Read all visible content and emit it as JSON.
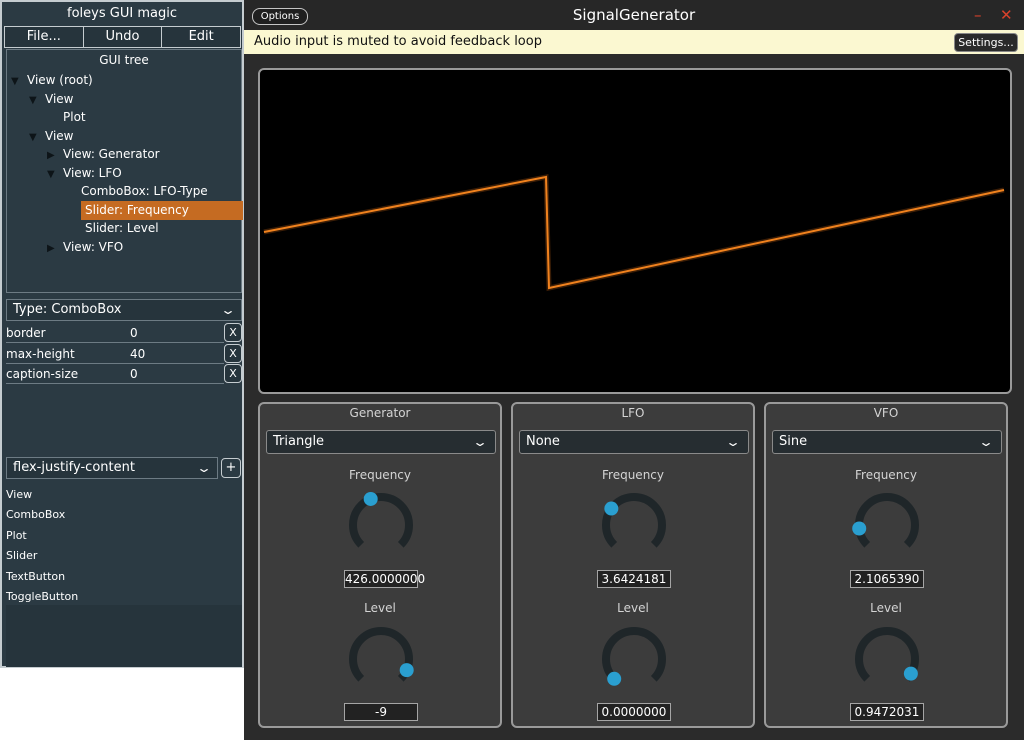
{
  "editor": {
    "title": "foleys GUI magic",
    "menu": [
      "File...",
      "Undo",
      "Edit"
    ],
    "tree_header": "GUI tree",
    "tree": [
      {
        "label": "View (root)",
        "expanded": true,
        "selected": false
      },
      {
        "label": "View",
        "expanded": true,
        "selected": false
      },
      {
        "label": "Plot",
        "expanded": null,
        "selected": false
      },
      {
        "label": "View",
        "expanded": true,
        "selected": false
      },
      {
        "label": "View: Generator",
        "expanded": false,
        "selected": false
      },
      {
        "label": "View: LFO",
        "expanded": true,
        "selected": false
      },
      {
        "label": "ComboBox: LFO-Type",
        "expanded": null,
        "selected": false
      },
      {
        "label": "Slider: Frequency",
        "expanded": null,
        "selected": true
      },
      {
        "label": "Slider: Level",
        "expanded": null,
        "selected": false
      },
      {
        "label": "View: VFO",
        "expanded": false,
        "selected": false
      }
    ],
    "type_selector": "Type: ComboBox",
    "properties": [
      {
        "name": "border",
        "value": "0",
        "remove": "X"
      },
      {
        "name": "max-height",
        "value": "40",
        "remove": "X"
      },
      {
        "name": "caption-size",
        "value": "0",
        "remove": "X"
      }
    ],
    "flex_selector": "flex-justify-content",
    "add_label": "+",
    "palette": [
      "View",
      "ComboBox",
      "Plot",
      "Slider",
      "TextButton",
      "ToggleButton"
    ]
  },
  "window": {
    "options_label": "Options",
    "title": "SignalGenerator",
    "minimize_glyph": "–",
    "close_glyph": "✕",
    "notice": "Audio input is muted to avoid feedback loop",
    "settings_label": "Settings...",
    "plot": {
      "trace_color": "#f0821e"
    },
    "groups": [
      {
        "title": "Generator",
        "combo": "Triangle",
        "freq_label": "Frequency",
        "freq_value": "426.0000000",
        "freq_pos": 0.42,
        "level_label": "Level",
        "level_value": "-9",
        "level_pos": 0.92
      },
      {
        "title": "LFO",
        "combo": "None",
        "freq_label": "Frequency",
        "freq_value": "3.6424181",
        "freq_pos": 0.3,
        "level_label": "Level",
        "level_value": "0.0000000",
        "level_pos": 0.0
      },
      {
        "title": "VFO",
        "combo": "Sine",
        "freq_label": "Frequency",
        "freq_value": "2.1065390",
        "freq_pos": 0.14,
        "level_label": "Level",
        "level_value": "0.9472031",
        "level_pos": 0.95
      }
    ],
    "colors": {
      "accent": "#2a9fd0",
      "selection": "#c56b22",
      "knob_track": "#1f2629"
    }
  }
}
